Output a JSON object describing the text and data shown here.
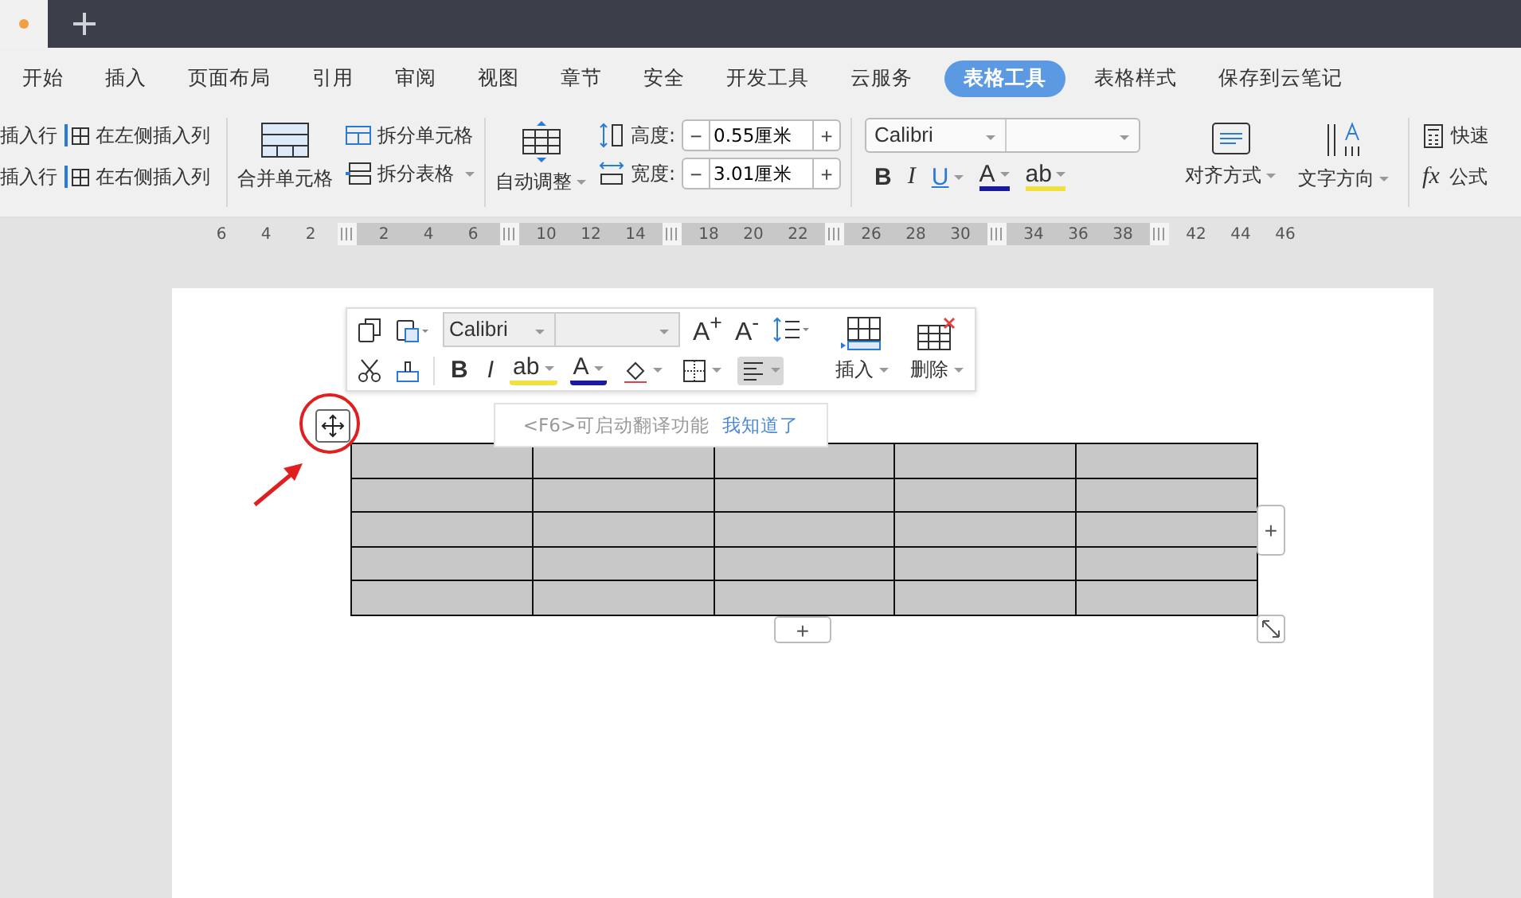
{
  "menu_tabs": [
    {
      "label": "开始",
      "selected": false
    },
    {
      "label": "插入",
      "selected": false
    },
    {
      "label": "页面布局",
      "selected": false
    },
    {
      "label": "引用",
      "selected": false
    },
    {
      "label": "审阅",
      "selected": false
    },
    {
      "label": "视图",
      "selected": false
    },
    {
      "label": "章节",
      "selected": false
    },
    {
      "label": "安全",
      "selected": false
    },
    {
      "label": "开发工具",
      "selected": false
    },
    {
      "label": "云服务",
      "selected": false
    },
    {
      "label": "表格工具",
      "selected": true
    },
    {
      "label": "表格样式",
      "selected": false
    },
    {
      "label": "保存到云笔记",
      "selected": false
    }
  ],
  "ribbon": {
    "insert_rows": [
      "插入行",
      "插入行"
    ],
    "insert_columns": [
      "在左侧插入列",
      "在右侧插入列"
    ],
    "merge_cells": "合并单元格",
    "split_cell": "拆分单元格",
    "split_table": "拆分表格",
    "autofit": "自动调整",
    "height": {
      "label": "高度:",
      "value": "0.55厘米",
      "minus": "−",
      "plus": "+"
    },
    "width": {
      "label": "宽度:",
      "value": "3.01厘米",
      "minus": "−",
      "plus": "+"
    },
    "font": "Calibri",
    "format_buttons": [
      {
        "kind": "bold",
        "label": "B"
      },
      {
        "kind": "italic",
        "label": "I"
      },
      {
        "kind": "underline",
        "label": "U"
      },
      {
        "kind": "font_color",
        "label": "A"
      },
      {
        "kind": "highlight",
        "label": "ab"
      }
    ],
    "align": "对齐方式",
    "text_direction": "文字方向",
    "quick_calc": "快速",
    "formula": {
      "icon": "fx",
      "label": "公式"
    }
  },
  "ruler": [
    {
      "kind": "margin",
      "numbers": [
        "6",
        "4",
        "2"
      ]
    },
    {
      "kind": "column",
      "numbers": [
        "2",
        "4",
        "6"
      ]
    },
    {
      "kind": "column",
      "numbers": [
        "10",
        "12",
        "14"
      ]
    },
    {
      "kind": "column",
      "numbers": [
        "18",
        "20",
        "22"
      ]
    },
    {
      "kind": "column",
      "numbers": [
        "26",
        "28",
        "30"
      ]
    },
    {
      "kind": "column",
      "numbers": [
        "34",
        "36",
        "38"
      ]
    },
    {
      "kind": "margin",
      "numbers": [
        "42",
        "44",
        "46"
      ]
    }
  ],
  "floating_toolbar": {
    "font": "Calibri",
    "grow_font": "A$^{+}$",
    "shrink_font": "A$^{-}$",
    "buttons": [
      {
        "kind": "bold",
        "label": "B",
        "selected": false
      },
      {
        "kind": "italic",
        "label": "I",
        "selected": false
      },
      {
        "kind": "highlight",
        "label": "ab",
        "selected": false
      },
      {
        "kind": "font_color",
        "label": "A",
        "selected": false
      },
      {
        "kind": "fill",
        "selected": false
      },
      {
        "kind": "borders",
        "selected": false
      },
      {
        "kind": "align",
        "selected": true
      }
    ],
    "insert": "插入",
    "delete": "删除"
  },
  "tooltip": {
    "text": "<F6>可启动翻译功能",
    "link": "我知道了"
  },
  "table": {
    "rows": [
      {
        "cells": [
          {
            "selected": true
          },
          {
            "selected": true
          },
          {
            "selected": true
          },
          {
            "selected": true
          },
          {
            "selected": true
          }
        ]
      },
      {
        "cells": [
          {
            "selected": true
          },
          {
            "selected": true
          },
          {
            "selected": true
          },
          {
            "selected": true
          },
          {
            "selected": true
          }
        ]
      },
      {
        "cells": [
          {
            "selected": true
          },
          {
            "selected": true
          },
          {
            "selected": true
          },
          {
            "selected": true
          },
          {
            "selected": true
          }
        ]
      },
      {
        "cells": [
          {
            "selected": true
          },
          {
            "selected": true
          },
          {
            "selected": true
          },
          {
            "selected": true
          },
          {
            "selected": true
          }
        ]
      },
      {
        "cells": [
          {
            "selected": true
          },
          {
            "selected": true
          },
          {
            "selected": true
          },
          {
            "selected": true
          },
          {
            "selected": true
          }
        ]
      }
    ]
  },
  "add_column": "+",
  "add_row": "+"
}
